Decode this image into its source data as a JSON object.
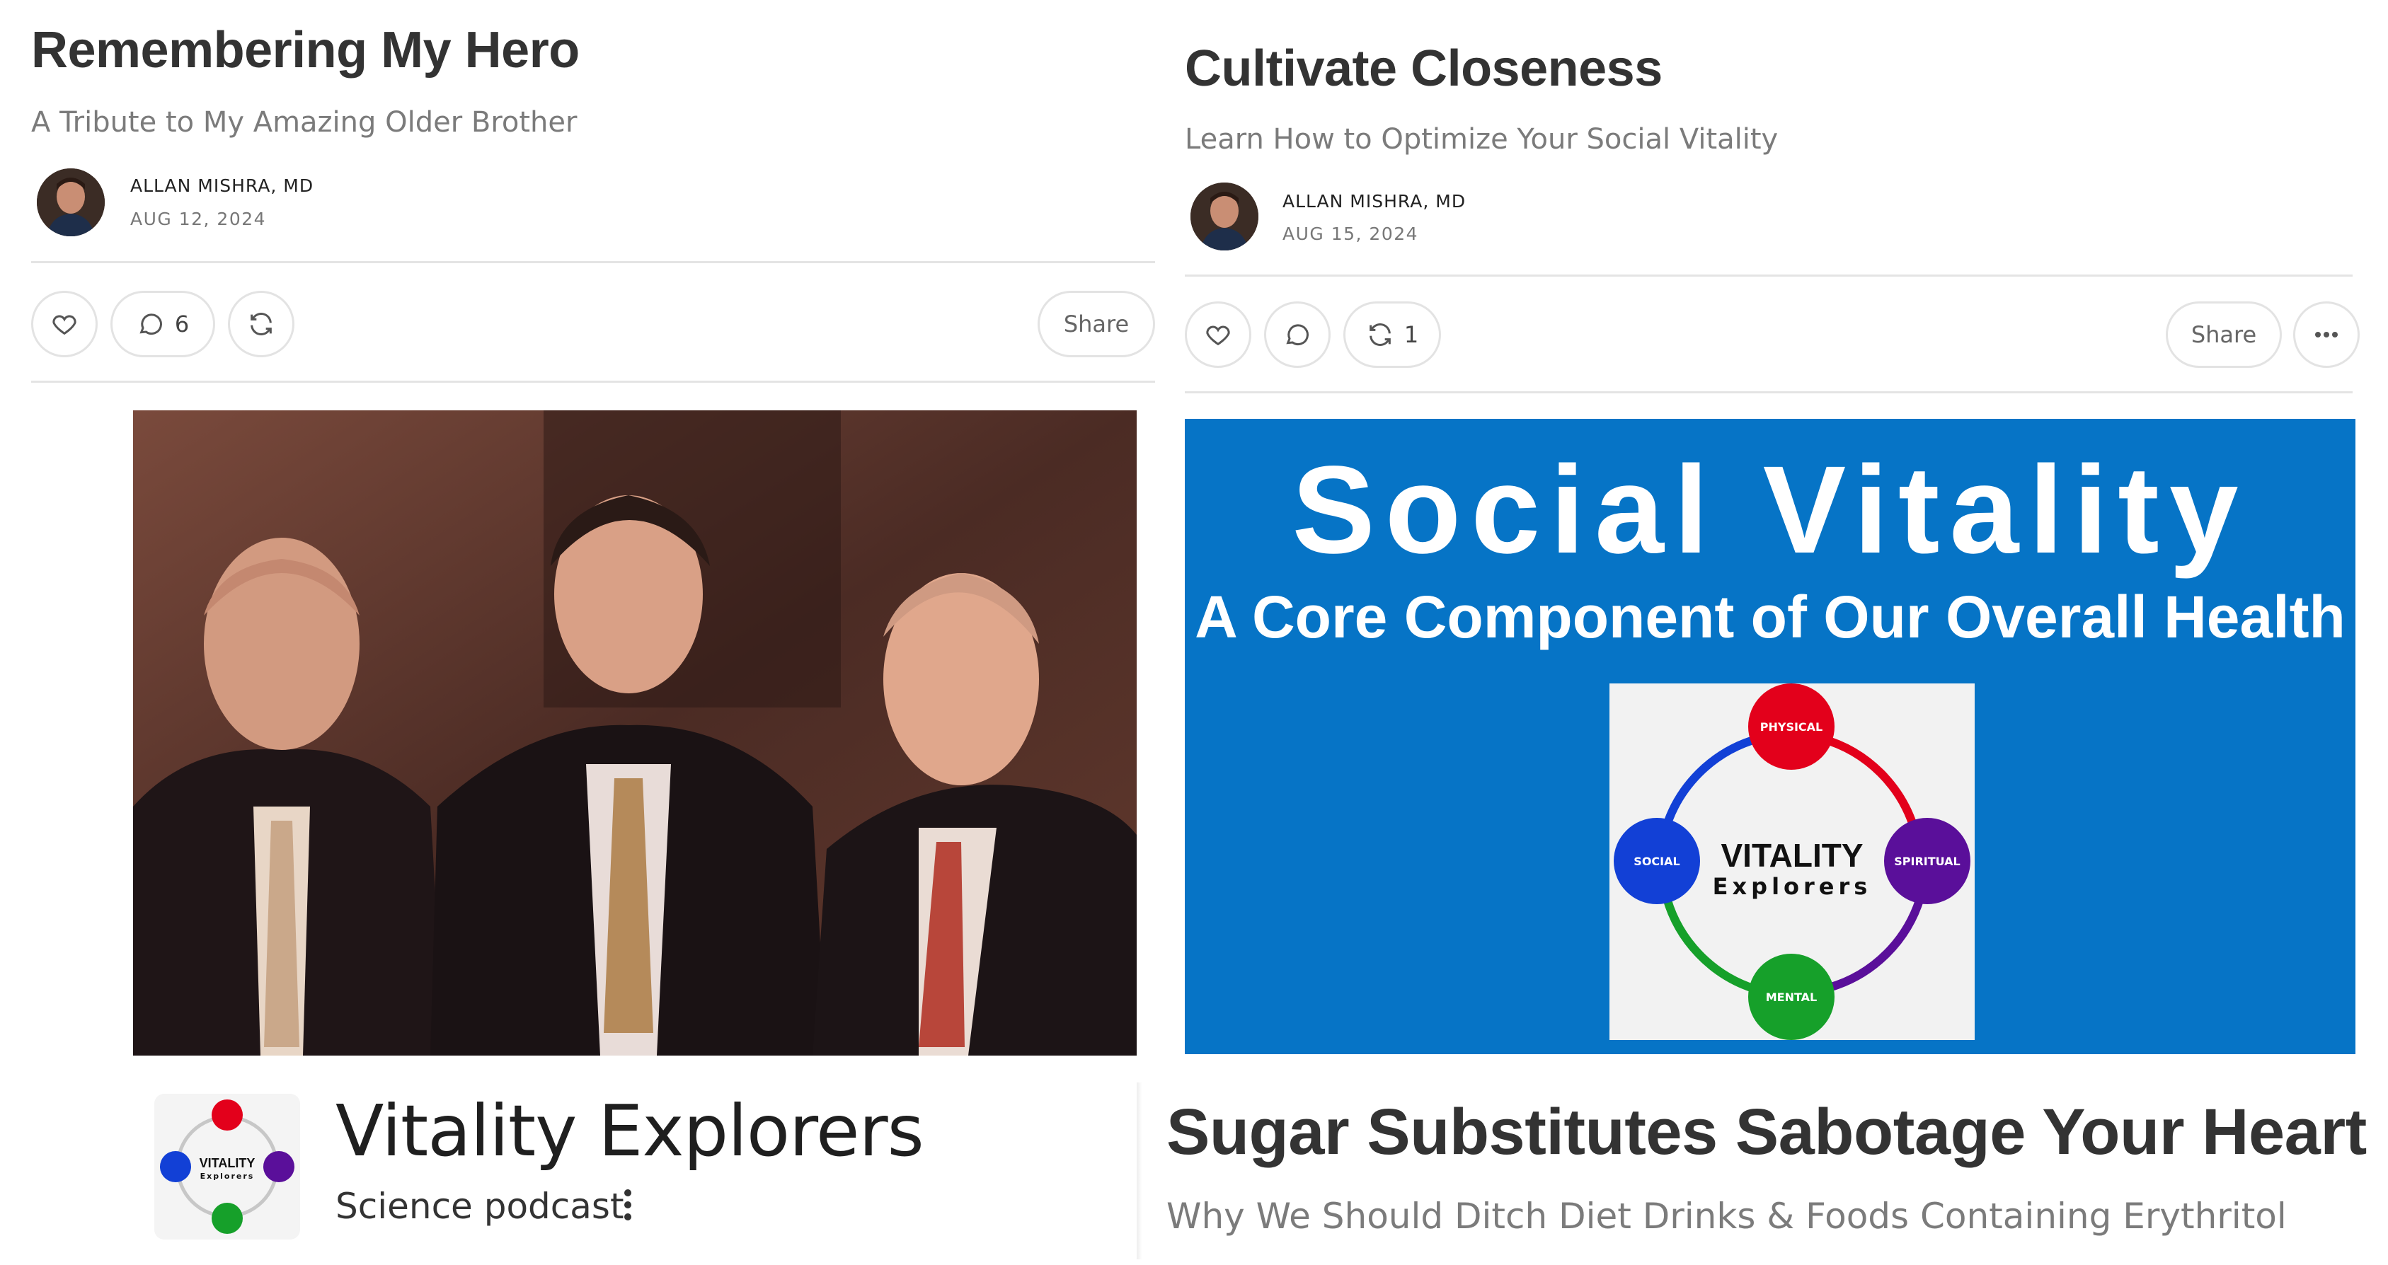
{
  "left_post": {
    "title": "Remembering My Hero",
    "subtitle": "A Tribute to My Amazing Older Brother",
    "author": "ALLAN MISHRA, MD",
    "date": "AUG 12, 2024",
    "actions": {
      "comments_count": "6",
      "share_label": "Share"
    }
  },
  "right_post": {
    "title": "Cultivate Closeness",
    "subtitle": "Learn How to Optimize Your Social Vitality",
    "author": "ALLAN MISHRA, MD",
    "date": "AUG 15, 2024",
    "actions": {
      "restacks_count": "1",
      "share_label": "Share"
    },
    "banner": {
      "title": "Social Vitality",
      "subtitle": "A Core Component of Our Overall Health",
      "diagram": {
        "center_line1": "VITALITY",
        "center_line2": "Explorers",
        "nodes": [
          {
            "label": "PHYSICAL",
            "color": "#e3001b"
          },
          {
            "label": "SPIRITUAL",
            "color": "#5a0f9a"
          },
          {
            "label": "MENTAL",
            "color": "#16a02a"
          },
          {
            "label": "SOCIAL",
            "color": "#1240d6"
          }
        ]
      }
    }
  },
  "podcast": {
    "title": "Vitality Explorers",
    "category": "Science podcast"
  },
  "bottom_post": {
    "title": "Sugar Substitutes Sabotage Your Heart",
    "subtitle": "Why We Should Ditch Diet Drinks & Foods Containing Erythritol"
  },
  "colors": {
    "banner_blue": "#0674c6",
    "divider": "#e4e4e4",
    "subtitle_gray": "#7b7b7b"
  }
}
